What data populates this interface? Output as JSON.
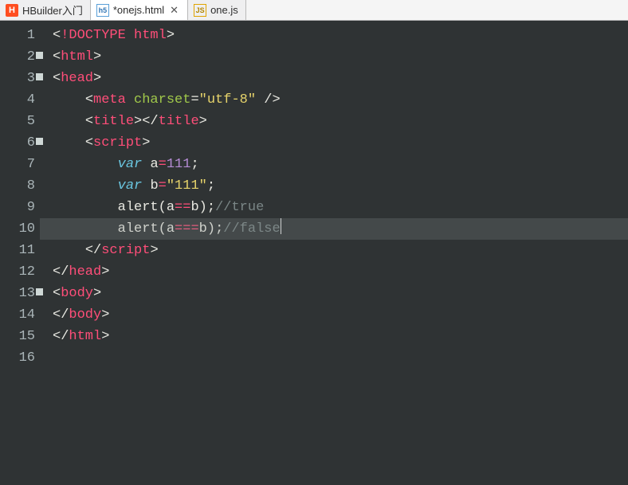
{
  "tabs": [
    {
      "icon": "H",
      "label": "HBuilder入门",
      "active": false,
      "closeable": false
    },
    {
      "icon": "h5",
      "label": "*onejs.html",
      "active": true,
      "closeable": true
    },
    {
      "icon": "JS",
      "label": "one.js",
      "active": false,
      "closeable": false
    }
  ],
  "code": {
    "lines": [
      {
        "n": "1",
        "fold": false
      },
      {
        "n": "2",
        "fold": true
      },
      {
        "n": "3",
        "fold": true
      },
      {
        "n": "4",
        "fold": false
      },
      {
        "n": "5",
        "fold": false
      },
      {
        "n": "6",
        "fold": true
      },
      {
        "n": "7",
        "fold": false
      },
      {
        "n": "8",
        "fold": false
      },
      {
        "n": "9",
        "fold": false
      },
      {
        "n": "10",
        "fold": false
      },
      {
        "n": "11",
        "fold": false
      },
      {
        "n": "12",
        "fold": false
      },
      {
        "n": "13",
        "fold": true
      },
      {
        "n": "14",
        "fold": false
      },
      {
        "n": "15",
        "fold": false
      },
      {
        "n": "16",
        "fold": false
      }
    ],
    "t": {
      "lt": "<",
      "gt": ">",
      "lts": "</",
      "sgt": " />",
      "sp2": "    ",
      "sp3": "        ",
      "doctype": "!DOCTYPE html",
      "html": "html",
      "head": "head",
      "meta": "meta",
      "title": "title",
      "script": "script",
      "body": "body",
      "charset_attr": " charset",
      "eq": "=",
      "utf8": "\"utf-8\"",
      "var": "var",
      "sp": " ",
      "a": "a",
      "b": "b",
      "assign": "=",
      "n111": "111",
      "s111": "\"111\"",
      "semi": ";",
      "alert": "alert",
      "lp": "(",
      "rp": ")",
      "eq2": "==",
      "eq3": "===",
      "cmt_true": "//true",
      "cmt_false": "//false",
      "gt_close": ">"
    }
  }
}
